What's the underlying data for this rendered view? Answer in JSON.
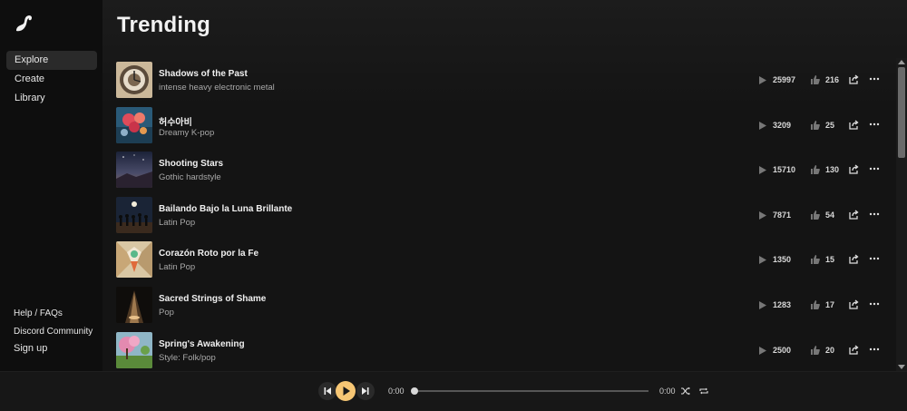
{
  "nav": {
    "items": [
      {
        "label": "Explore",
        "active": true
      },
      {
        "label": "Create"
      },
      {
        "label": "Library"
      }
    ],
    "bottom": [
      {
        "label": "Help / FAQs"
      },
      {
        "label": "Discord Community"
      },
      {
        "label": "Sign up"
      }
    ]
  },
  "page": {
    "title": "Trending"
  },
  "songs": [
    {
      "title": "Shadows of the Past",
      "subtitle": "intense heavy electronic metal",
      "plays": "25997",
      "likes": "216"
    },
    {
      "title": "허수아비",
      "subtitle": "Dreamy K-pop",
      "plays": "3209",
      "likes": "25"
    },
    {
      "title": "Shooting Stars",
      "subtitle": "Gothic hardstyle",
      "plays": "15710",
      "likes": "130"
    },
    {
      "title": "Bailando Bajo la Luna Brillante",
      "subtitle": "Latin Pop",
      "plays": "7871",
      "likes": "54"
    },
    {
      "title": "Corazón Roto por la Fe",
      "subtitle": "Latin Pop",
      "plays": "1350",
      "likes": "15"
    },
    {
      "title": "Sacred Strings of Shame",
      "subtitle": "Pop",
      "plays": "1283",
      "likes": "17"
    },
    {
      "title": "Spring's Awakening",
      "subtitle": "Style: Folk/pop",
      "plays": "2500",
      "likes": "20"
    }
  ],
  "player": {
    "current_time": "0:00",
    "total_time": "0:00",
    "accent": "#f6c674"
  },
  "icons": {
    "logo": "logo-icon",
    "play_count": "play-icon",
    "like": "thumbs-up-icon",
    "share": "share-icon",
    "more": "more-icon"
  }
}
